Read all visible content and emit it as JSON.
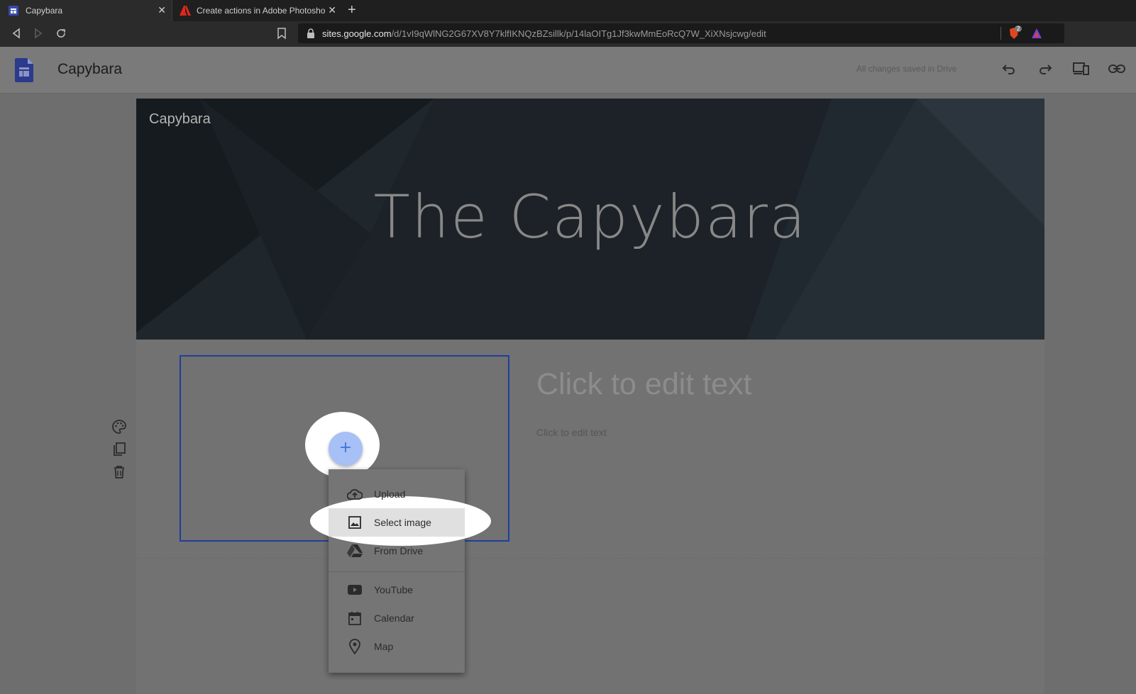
{
  "browser": {
    "tabs": [
      {
        "title": "Capybara",
        "active": true
      },
      {
        "title": "Create actions in Adobe Photosho",
        "active": false
      }
    ],
    "url_host": "sites.google.com",
    "url_path": "/d/1vI9qWlNG2G67XV8Y7klfIKNQzBZsillk/p/14laOITg1Jf3kwMmEoRcQ7W_XiXNsjcwg/edit",
    "extension_badge": "2"
  },
  "header": {
    "site_title": "Capybara",
    "save_status": "All changes saved in Drive"
  },
  "banner": {
    "site_name": "Capybara",
    "page_title": "The Capybara"
  },
  "content": {
    "heading_placeholder": "Click to edit text",
    "body_placeholder": "Click to edit text"
  },
  "insert_menu": {
    "items": [
      {
        "label": "Upload",
        "icon": "cloud-upload-icon"
      },
      {
        "label": "Select image",
        "icon": "image-icon"
      },
      {
        "label": "From Drive",
        "icon": "drive-icon"
      },
      {
        "label": "YouTube",
        "icon": "youtube-icon"
      },
      {
        "label": "Calendar",
        "icon": "calendar-icon"
      },
      {
        "label": "Map",
        "icon": "map-pin-icon"
      }
    ],
    "highlighted_item": "Select image"
  },
  "colors": {
    "selection_border": "#1e3f9c",
    "fab": "#a7c0f5",
    "sites_logo": "#3949ab"
  }
}
